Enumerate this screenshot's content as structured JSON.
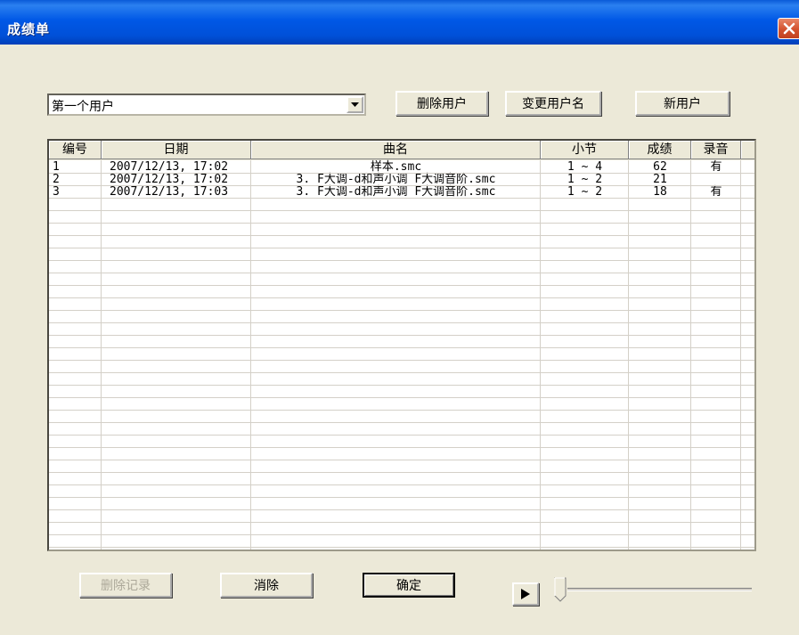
{
  "window": {
    "title": "成绩单"
  },
  "user_select": {
    "value": "第一个用户"
  },
  "buttons": {
    "delete_user": "删除用户",
    "rename_user": "变更用户名",
    "new_user": "新用户",
    "delete_record": "删除记录",
    "clear": "消除",
    "ok": "确定"
  },
  "table": {
    "columns": [
      "编号",
      "日期",
      "曲名",
      "小节",
      "成绩",
      "录音"
    ],
    "rows": [
      {
        "no": "1",
        "date": "2007/12/13, 17:02",
        "song": "样本.smc",
        "measures": "1 ~ 4",
        "score": "62",
        "recording": "有"
      },
      {
        "no": "2",
        "date": "2007/12/13, 17:02",
        "song": "3. F大调-d和声小调 F大调音阶.smc",
        "measures": "1 ~ 2",
        "score": "21",
        "recording": ""
      },
      {
        "no": "3",
        "date": "2007/12/13, 17:03",
        "song": "3. F大调-d和声小调 F大调音阶.smc",
        "measures": "1 ~ 2",
        "score": "18",
        "recording": "有"
      }
    ]
  },
  "playback": {
    "slider_position": 0
  },
  "icons": {
    "close": "close-icon",
    "dropdown": "dropdown-arrow-icon",
    "play": "play-icon"
  }
}
